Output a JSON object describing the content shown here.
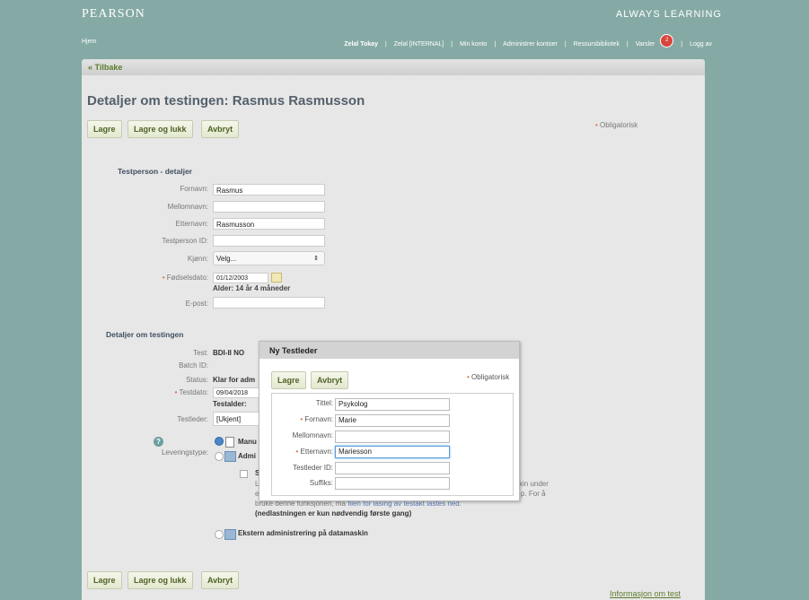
{
  "header": {
    "brand": "PEARSON",
    "tagline": "ALWAYS LEARNING"
  },
  "nav": {
    "home": "Hjem",
    "user": "Zelal Tokay",
    "sep": "|",
    "items": [
      "Zelal [INTERNAL]",
      "Min konto",
      "Administrer kontoer",
      "Ressursbibliotek",
      "Varsler"
    ],
    "badge": "2",
    "logout": "Logg av"
  },
  "back": "« Tilbake",
  "page_title": "Detaljer om testingen: Rasmus Rasmusson",
  "buttons": {
    "save": "Lagre",
    "save_close": "Lagre og lukk",
    "cancel": "Avbryt"
  },
  "required_note": "Obligatorisk",
  "required_mark": "•",
  "person": {
    "section": "Testperson - detaljer",
    "first_name_label": "Fornavn:",
    "first_name": "Rasmus",
    "middle_name_label": "Mellomnavn:",
    "middle_name": "",
    "last_name_label": "Etternavn:",
    "last_name": "Rasmusson",
    "id_label": "Testperson ID:",
    "id": "",
    "gender_label": "Kjønn:",
    "gender": "Velg...",
    "birth_label": "Fødselsdato:",
    "birth": "01/12/2003",
    "age": "Alder:  14 år 4 måneder",
    "email_label": "E-post:",
    "email": ""
  },
  "testing": {
    "section": "Detaljer om testingen",
    "test_label": "Test:",
    "test": "BDI-II NO",
    "batch_label": "Batch ID:",
    "status_label": "Status:",
    "status": "Klar for adm",
    "date_label": "Testdato:",
    "date": "09/04/2018",
    "test_age": "Testalder:",
    "leader_label": "Testleder:",
    "leader": "[Ukjent]",
    "delivery_label": "Leveringstype:",
    "delivery_1": "Manu",
    "delivery_2": "Admi",
    "sub_option": "St",
    "sub_l1a": "Lå",
    "sub_l1b": "kin under",
    "sub_l2a": "ell",
    "sub_l2b": "p. For å",
    "sub_l3a": "bruke denne funksjonen, må ",
    "sub_l3link": "filen for lasing av testakt lastes ned.",
    "sub_l4": "(nedlastningen er kun nødvendig første gang)",
    "external": "Ekstern administrering på datamaskin"
  },
  "footer_link": "Informasjon om test",
  "dialog": {
    "title": "Ny Testleder",
    "save": "Lagre",
    "cancel": "Avbryt",
    "required_note": "Obligatorisk",
    "title_label": "Tittel:",
    "title_value": "Psykolog",
    "first_label": "Fornavn:",
    "first_value": "Marie",
    "middle_label": "Mellomnavn:",
    "middle_value": "",
    "last_label": "Etternavn:",
    "last_value": "Mariesson",
    "id_label": "Testleder ID:",
    "id_value": "",
    "suffix_label": "Suffiks:",
    "suffix_value": ""
  },
  "colors": {
    "teal": "#85aaa6",
    "panel": "#e7e7e7",
    "accent_green": "#5e7d2e",
    "required": "#e06a3d"
  }
}
